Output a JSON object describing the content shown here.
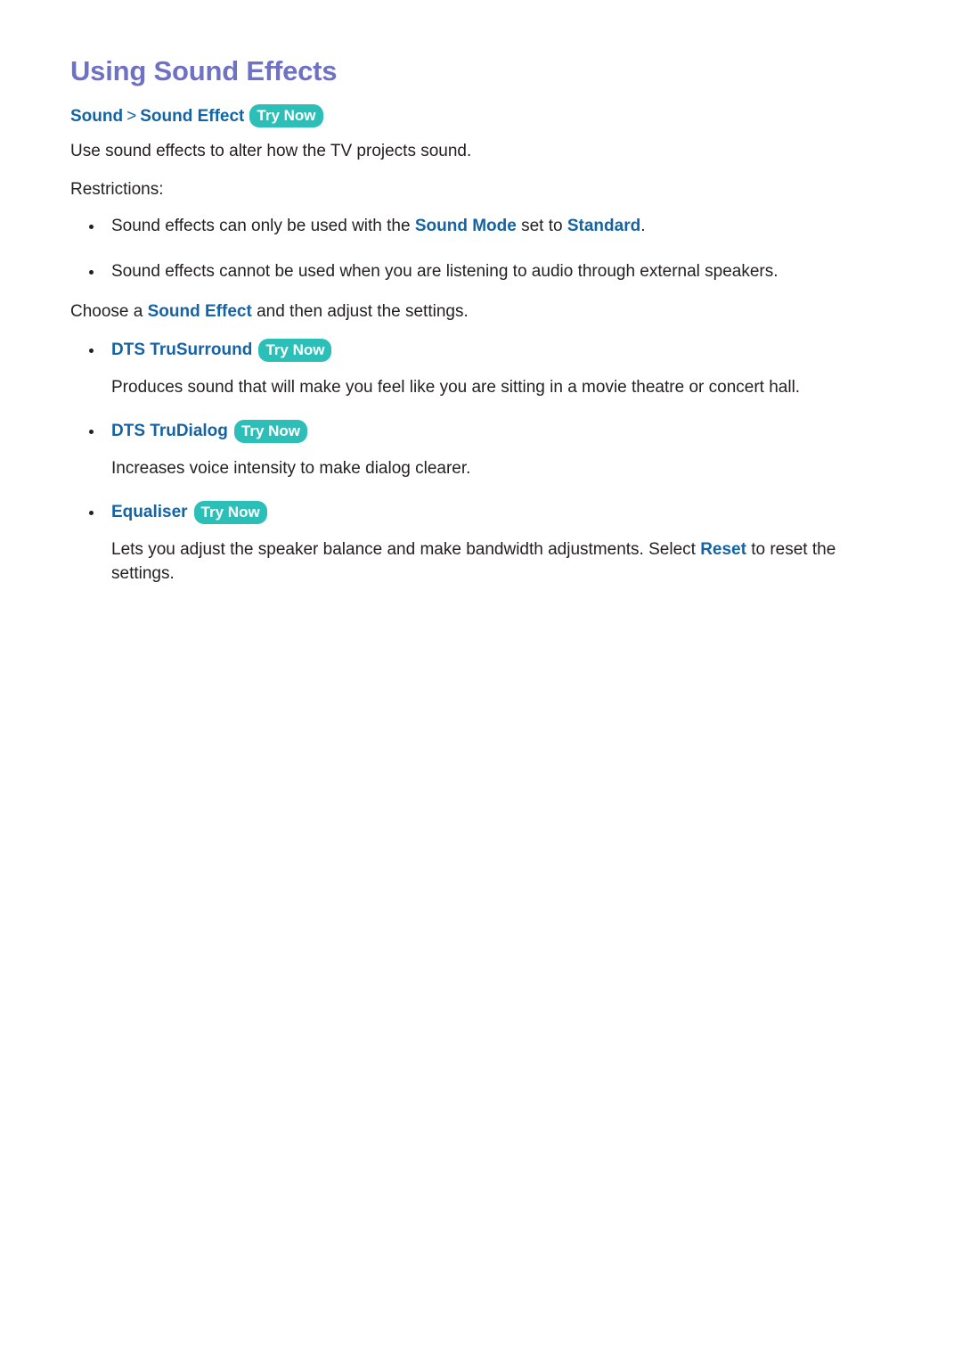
{
  "document": {
    "title": "Using Sound Effects",
    "badge_label": "Try Now",
    "colors": {
      "title": "#6f72c4",
      "link": "#1464a5",
      "badge_background": "#2bbfb8",
      "badge_text": "#ffffff",
      "body_text": "#231f20"
    },
    "breadcrumb": {
      "items": [
        "Sound",
        "Sound Effect"
      ],
      "separator": ">"
    },
    "intro": "Use sound effects to alter how the TV projects sound.",
    "restrictions_label": "Restrictions:",
    "restrictions": [
      {
        "prefix": "Sound effects can only be used with the ",
        "link1": "Sound Mode",
        "middle": " set to ",
        "link2": "Standard",
        "suffix": "."
      },
      {
        "prefix": "Sound effects cannot be used when you are listening to audio through external speakers.",
        "link1": "",
        "middle": "",
        "link2": "",
        "suffix": ""
      }
    ],
    "choose_line": {
      "prefix": "Choose a ",
      "link": "Sound Effect",
      "suffix": " and then adjust the settings."
    },
    "sections": [
      {
        "heading": "DTS TruSurround",
        "badge": "Try Now",
        "body_prefix": "Produces sound that will make you feel like you are sitting in a movie theatre or concert hall.",
        "body_link": "",
        "body_suffix": ""
      },
      {
        "heading": "DTS TruDialog",
        "badge": "Try Now",
        "body_prefix": "Increases voice intensity to make dialog clearer.",
        "body_link": "",
        "body_suffix": ""
      },
      {
        "heading": "Equaliser",
        "badge": "Try Now",
        "body_prefix": "Lets you adjust the speaker balance and make bandwidth adjustments. Select ",
        "body_link": "Reset",
        "body_suffix": " to reset the settings."
      }
    ]
  }
}
